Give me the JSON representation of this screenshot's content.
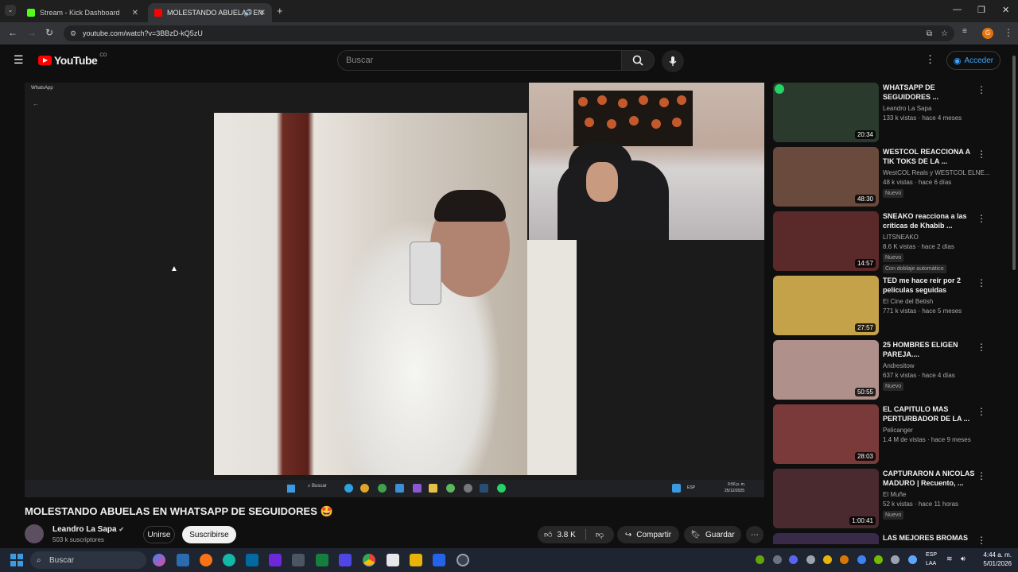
{
  "browser": {
    "tabs": [
      {
        "label": "Stream - Kick Dashboard",
        "active": false
      },
      {
        "label": "MOLESTANDO ABUELAS EN",
        "active": true
      }
    ],
    "url": "youtube.com/watch?v=3BBzD-kQ5zU",
    "window_controls": [
      "—",
      "❐",
      "✕"
    ]
  },
  "youtube": {
    "logo_text": "YouTube",
    "country_code": "CO",
    "search_placeholder": "Buscar",
    "signin_label": "Acceder"
  },
  "video": {
    "inner_app_label": "WhatsApp",
    "inner_taskbar": {
      "search_label": "Buscar",
      "lang": "ESP",
      "time": "9:56 p. m.",
      "date": "25/12/2025"
    },
    "title": "MOLESTANDO ABUELAS EN WHATSAPP DE SEGUIDORES 🤩",
    "channel": "Leandro La Sapa",
    "subscribers": "503 k suscriptores",
    "join_label": "Unirse",
    "subscribe_label": "Suscribirse",
    "likes": "3.8 K",
    "share_label": "Compartir",
    "save_label": "Guardar"
  },
  "recommendations": [
    {
      "title": "WHATSAPP DE SEGUIDORES ...",
      "channel": "Leandro La Sapa",
      "meta": "133 k vistas · hace 4 meses",
      "duration": "20:34",
      "badge": "",
      "badge2": "",
      "thumb_color": "#2a3a2c"
    },
    {
      "title": "WESTCOL REACCIONA A TIK TOKS DE LA ...",
      "channel": "WestCOL Reals y WESTCOL ELNE...",
      "meta": "48 k vistas · hace 6 días",
      "duration": "48:30",
      "badge": "Nuevo",
      "badge2": "",
      "thumb_color": "#6a4a3c"
    },
    {
      "title": "SNEAKO reacciona a las críticas de Khabib ...",
      "channel": "LITSNEAKO",
      "meta": "8.6 K vistas · hace 2 días",
      "duration": "14:57",
      "badge": "Nuevo",
      "badge2": "Con doblaje automático",
      "thumb_color": "#5a2a2a"
    },
    {
      "title": "TED me hace reír por 2 películas seguidas",
      "channel": "El Cine del Betish",
      "meta": "771 k vistas · hace 5 meses",
      "duration": "27:57",
      "badge": "",
      "badge2": "",
      "thumb_color": "#c4a24a"
    },
    {
      "title": "25 HOMBRES ELIGEN PAREJA....",
      "channel": "Andresitow",
      "meta": "637 k vistas · hace 4 días",
      "duration": "50:55",
      "badge": "Nuevo",
      "badge2": "",
      "thumb_color": "#b0908a"
    },
    {
      "title": "EL CAPITULO MAS PERTURBADOR DE LA ...",
      "channel": "Pelicanger",
      "meta": "1.4 M de vistas · hace 9 meses",
      "duration": "28:03",
      "badge": "",
      "badge2": "",
      "thumb_color": "#7a3a3a"
    },
    {
      "title": "CAPTURARON A NICOLAS MADURO | Recuento, ...",
      "channel": "El Muñe",
      "meta": "52 k vistas · hace 11 horas",
      "duration": "1:00:41",
      "badge": "Nuevo",
      "badge2": "",
      "thumb_color": "#4a2a2e"
    },
    {
      "title": "LAS MEJORES BROMAS",
      "channel": "",
      "meta": "",
      "duration": "",
      "badge": "",
      "badge2": "",
      "thumb_color": "#3a2a4a"
    }
  ],
  "windows_taskbar": {
    "search_label": "Buscar",
    "lang_top": "ESP",
    "lang_bottom": "LAA",
    "time": "4:44 a. m.",
    "date": "5/01/2026"
  }
}
